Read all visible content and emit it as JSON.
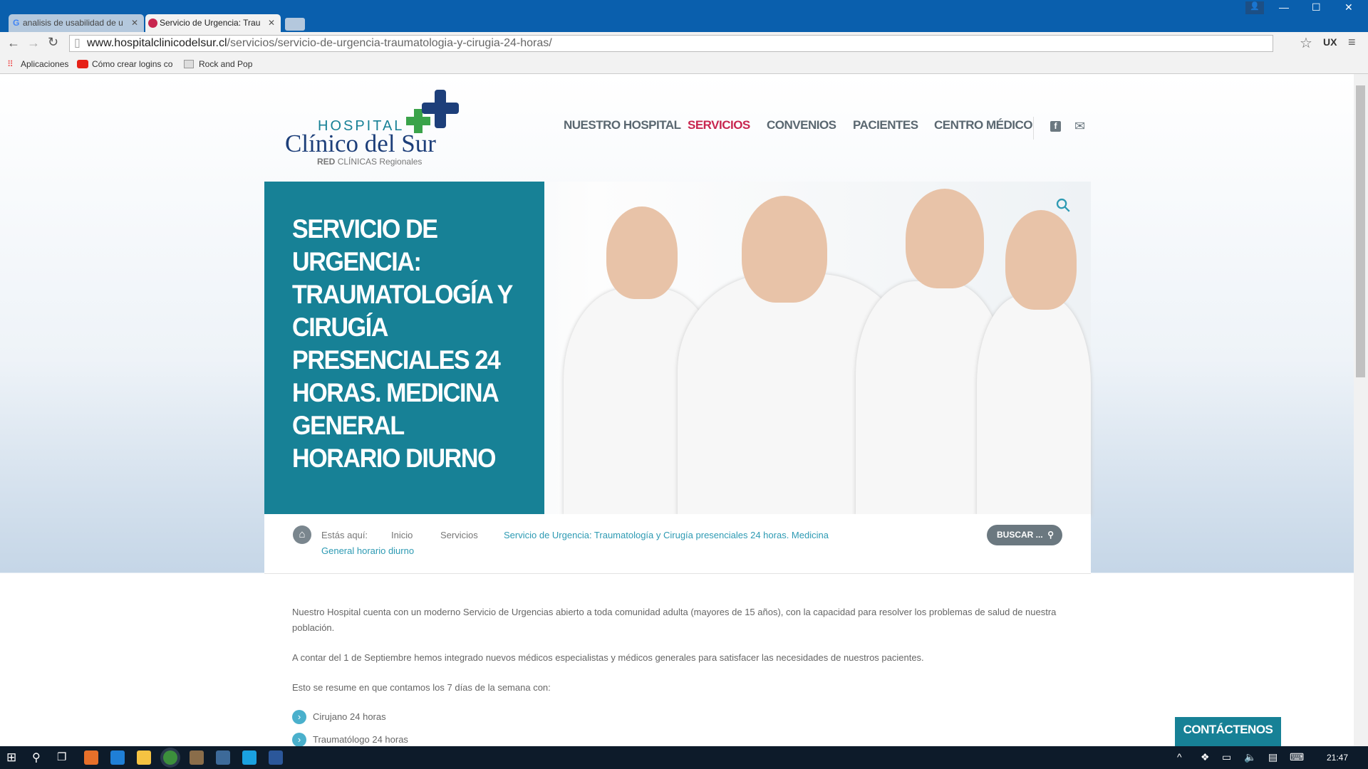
{
  "browser": {
    "tabs": [
      {
        "title": "analisis de usabilidad de u"
      },
      {
        "title": "Servicio de Urgencia: Trau"
      }
    ],
    "url_host": "www.hospitalclinicodelsur.cl",
    "url_path": "/servicios/servicio-de-urgencia-traumatologia-y-cirugia-24-horas/",
    "bookmarks": [
      "Aplicaciones",
      "Cómo crear logins co",
      "Rock and Pop"
    ],
    "ext_label": "UX"
  },
  "site": {
    "logo": {
      "line1": "HOSPITAL",
      "line2": "Clínico del Sur",
      "line3a": "RED",
      "line3b": "CLÍNICAS Regionales"
    },
    "nav": [
      "NUESTRO HOSPITAL",
      "SERVICIOS",
      "CONVENIOS",
      "PACIENTES",
      "CENTRO MÉDICO"
    ],
    "active_nav": "SERVICIOS",
    "hero_title": "SERVICIO DE URGENCIA: TRAUMATOLOGÍA Y CIRUGÍA PRESENCIALES 24 HORAS. MEDICINA GENERAL HORARIO DIURNO",
    "breadcrumb": {
      "label": "Estás aquí:",
      "items": [
        "Inicio",
        "Servicios"
      ],
      "current_line1": "Servicio de Urgencia: Traumatología y Cirugía presenciales 24 horas. Medicina",
      "current_line2": "General horario diurno"
    },
    "search_button": "BUSCAR ...",
    "paragraphs": [
      "Nuestro Hospital cuenta con un moderno Servicio de Urgencias abierto a toda comunidad adulta (mayores de 15 años), con la capacidad para resolver los problemas de salud de nuestra población.",
      "A contar del 1 de Septiembre hemos integrado nuevos médicos especialistas y médicos generales para satisfacer las necesidades de nuestros pacientes.",
      "Esto se resume en que contamos los 7 días de la semana con:"
    ],
    "list": [
      "Cirujano 24 horas",
      "Traumatólogo 24 horas"
    ],
    "contact_button": "CONTÁCTENOS",
    "colors": {
      "teal": "#178196",
      "accent": "#c8264f",
      "nav": "#5a6770"
    }
  },
  "taskbar": {
    "time": "21:47"
  }
}
